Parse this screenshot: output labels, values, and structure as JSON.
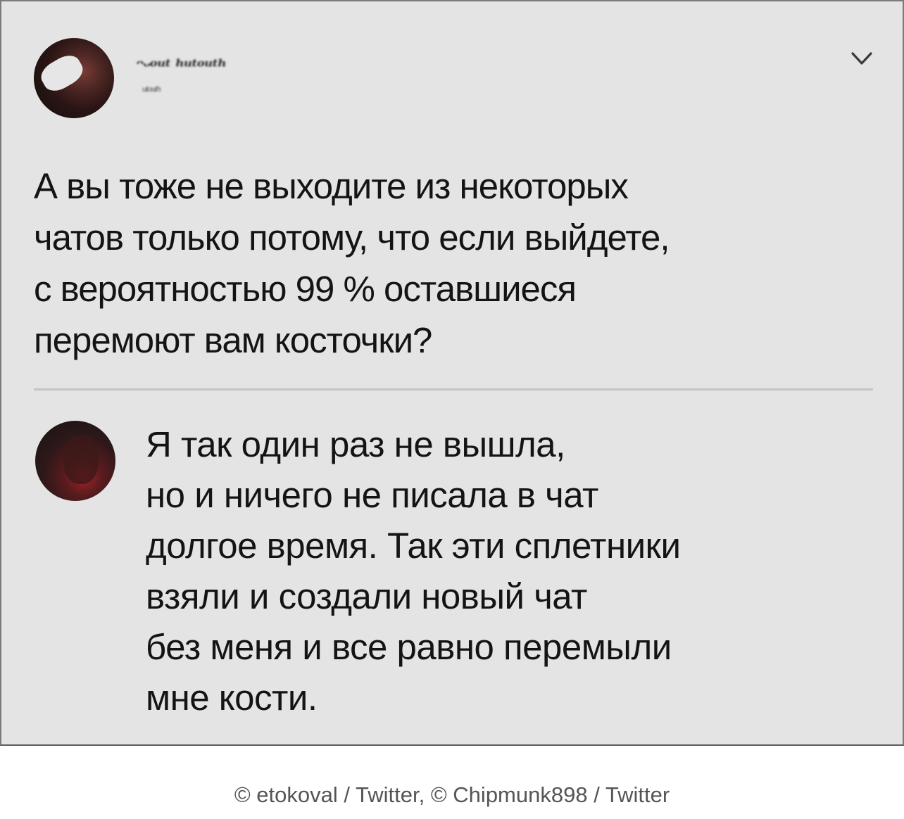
{
  "tweet": {
    "author_name": "ᵔᵕᵒᵘᵗ ʰᵘᵗᵒᵘᵗʰ",
    "author_handle": "ᵘᵗᵒᵘᵗʰ",
    "menu_icon": "chevron-down-icon",
    "text_lines": [
      "А вы тоже не выходите из некоторых",
      "чатов только потому, что если выйдете,",
      "с вероятностью 99 % оставшиеся",
      "перемоют вам косточки?"
    ]
  },
  "reply": {
    "text_lines": [
      "Я так один раз не вышла,",
      "но и ничего не писала в чат",
      "долгое время. Так эти сплетники",
      "взяли и создали новый чат",
      "без меня и все равно перемыли",
      "мне кости."
    ]
  },
  "credits": "© etokoval / Twitter, © Chipmunk898 / Twitter",
  "colors": {
    "card_background": "#e4e4e4",
    "text": "#141414",
    "divider": "#c4c4c4",
    "credits": "#555555"
  }
}
